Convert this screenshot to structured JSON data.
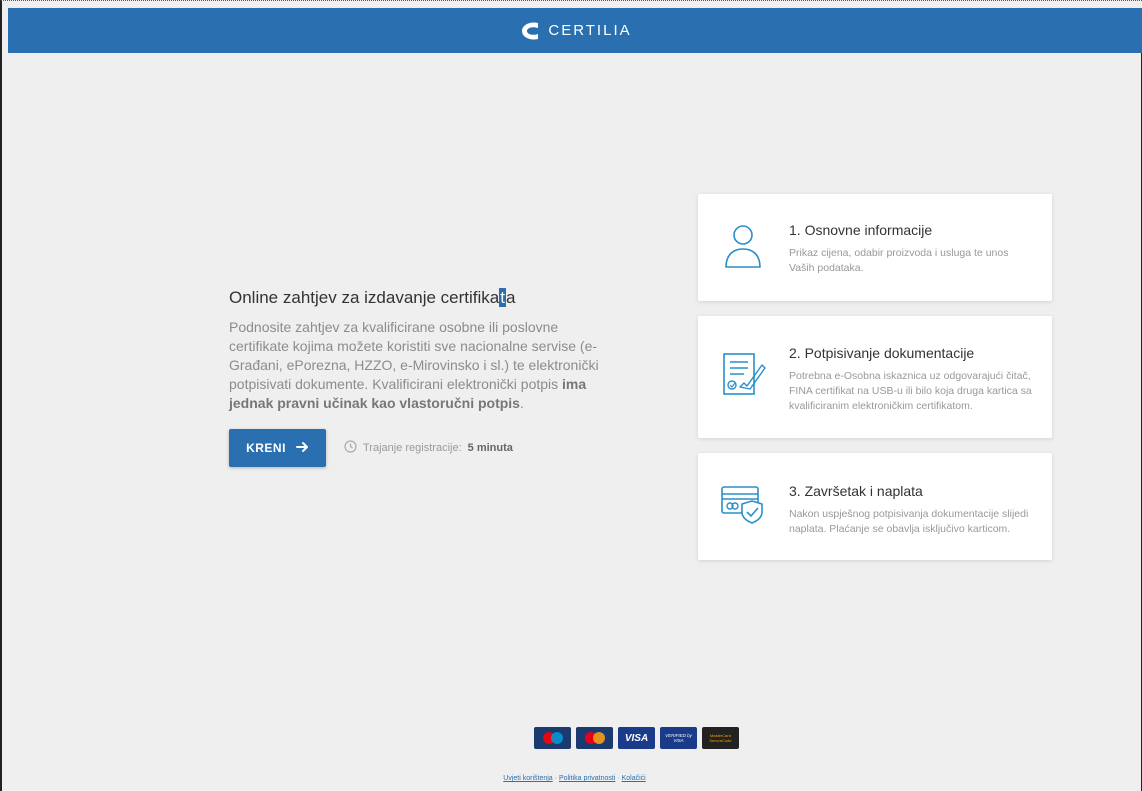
{
  "header": {
    "brand_name": "CERTILIA",
    "logo_icon": "certilia-logo-icon",
    "color": "#2a6fb0"
  },
  "intro": {
    "title_part1": "Online zahtjev za izdavanje certifika",
    "title_highlight": "t",
    "title_part2": "a",
    "text": "Podnosite zahtjev za kvalificirane osobne ili poslovne certifikate kojima možete koristiti sve nacionalne servise (e-Građani, ePorezna, HZZO, e-Mirovinsko i sl.) te elektronički potpisivati dokumente. Kvalificirani elektronički potpis ",
    "text_bold": "ima jednak pravni učinak kao vlastoručni potpis",
    "text_end": "."
  },
  "cta": {
    "button_label": "KRENI",
    "arrow_icon": "arrow-right-icon",
    "duration_label": "Trajanje registracije:",
    "duration_value": "5 minuta",
    "clock_icon": "clock-icon"
  },
  "steps": [
    {
      "title": "1. Osnovne informacije",
      "text": "Prikaz cijena, odabir proizvoda i usluga te unos Vaših podataka.",
      "icon": "user-icon"
    },
    {
      "title": "2. Potpisivanje dokumentacije",
      "text": "Potrebna e-Osobna iskaznica uz odgovarajući čitač, FINA certifikat na USB-u ili bilo koja druga kartica sa kvalificiranim elektroničkim certifikatom.",
      "icon": "signed-document-icon"
    },
    {
      "title": "3. Završetak i naplata",
      "text": "Nakon uspješnog potpisivanja dokumentacije slijedi naplata. Plaćanje se obavlja isključivo karticom.",
      "icon": "secure-payment-card-icon"
    }
  ],
  "footer": {
    "payment_cards": [
      {
        "name": "maestro-logo",
        "label": "maestro"
      },
      {
        "name": "mastercard-logo",
        "label": "mastercard"
      },
      {
        "name": "visa-logo",
        "label": "VISA"
      },
      {
        "name": "verified-by-visa-logo",
        "label": "VERIFIED by VISA"
      },
      {
        "name": "mastercard-securecode-logo",
        "label": "MasterCard SecureCode"
      }
    ],
    "links": {
      "terms": "Uvjeti korištenja",
      "privacy": "Politika privatnosti",
      "cookies": "Kolačići",
      "separator": " · "
    }
  }
}
